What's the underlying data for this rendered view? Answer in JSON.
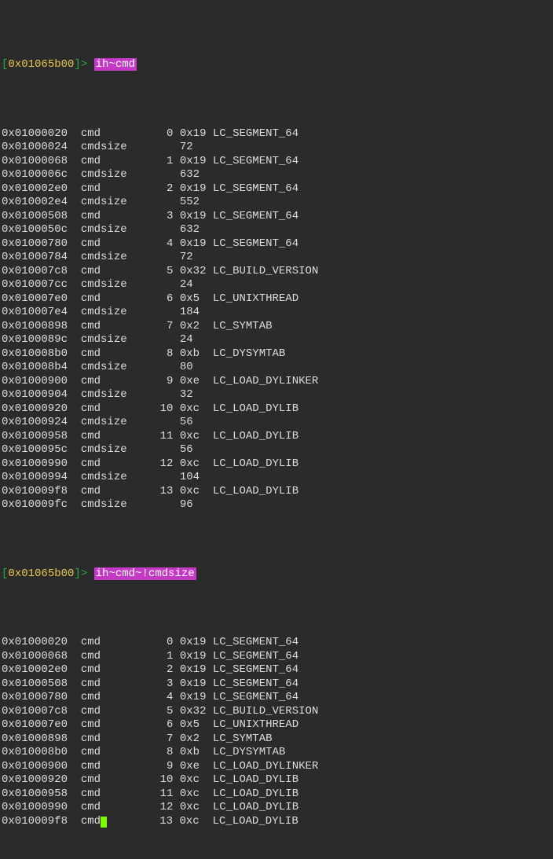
{
  "prompt1": {
    "lb": "[",
    "addr": "0x01065b00",
    "rb": "]",
    "gt": "> ",
    "command": "ih~cmd"
  },
  "block1": [
    {
      "addr": "0x01000020",
      "name": "cmd",
      "idx": "0",
      "hex": "0x19",
      "desc": "LC_SEGMENT_64"
    },
    {
      "addr": "0x01000024",
      "name": "cmdsize",
      "idx": "",
      "hex": "72",
      "desc": ""
    },
    {
      "addr": "0x01000068",
      "name": "cmd",
      "idx": "1",
      "hex": "0x19",
      "desc": "LC_SEGMENT_64"
    },
    {
      "addr": "0x0100006c",
      "name": "cmdsize",
      "idx": "",
      "hex": "632",
      "desc": ""
    },
    {
      "addr": "0x010002e0",
      "name": "cmd",
      "idx": "2",
      "hex": "0x19",
      "desc": "LC_SEGMENT_64"
    },
    {
      "addr": "0x010002e4",
      "name": "cmdsize",
      "idx": "",
      "hex": "552",
      "desc": ""
    },
    {
      "addr": "0x01000508",
      "name": "cmd",
      "idx": "3",
      "hex": "0x19",
      "desc": "LC_SEGMENT_64"
    },
    {
      "addr": "0x0100050c",
      "name": "cmdsize",
      "idx": "",
      "hex": "632",
      "desc": ""
    },
    {
      "addr": "0x01000780",
      "name": "cmd",
      "idx": "4",
      "hex": "0x19",
      "desc": "LC_SEGMENT_64"
    },
    {
      "addr": "0x01000784",
      "name": "cmdsize",
      "idx": "",
      "hex": "72",
      "desc": ""
    },
    {
      "addr": "0x010007c8",
      "name": "cmd",
      "idx": "5",
      "hex": "0x32",
      "desc": "LC_BUILD_VERSION"
    },
    {
      "addr": "0x010007cc",
      "name": "cmdsize",
      "idx": "",
      "hex": "24",
      "desc": ""
    },
    {
      "addr": "0x010007e0",
      "name": "cmd",
      "idx": "6",
      "hex": "0x5",
      "desc": "LC_UNIXTHREAD"
    },
    {
      "addr": "0x010007e4",
      "name": "cmdsize",
      "idx": "",
      "hex": "184",
      "desc": ""
    },
    {
      "addr": "0x01000898",
      "name": "cmd",
      "idx": "7",
      "hex": "0x2",
      "desc": "LC_SYMTAB"
    },
    {
      "addr": "0x0100089c",
      "name": "cmdsize",
      "idx": "",
      "hex": "24",
      "desc": ""
    },
    {
      "addr": "0x010008b0",
      "name": "cmd",
      "idx": "8",
      "hex": "0xb",
      "desc": "LC_DYSYMTAB"
    },
    {
      "addr": "0x010008b4",
      "name": "cmdsize",
      "idx": "",
      "hex": "80",
      "desc": ""
    },
    {
      "addr": "0x01000900",
      "name": "cmd",
      "idx": "9",
      "hex": "0xe",
      "desc": "LC_LOAD_DYLINKER"
    },
    {
      "addr": "0x01000904",
      "name": "cmdsize",
      "idx": "",
      "hex": "32",
      "desc": ""
    },
    {
      "addr": "0x01000920",
      "name": "cmd",
      "idx": "10",
      "hex": "0xc",
      "desc": "LC_LOAD_DYLIB"
    },
    {
      "addr": "0x01000924",
      "name": "cmdsize",
      "idx": "",
      "hex": "56",
      "desc": ""
    },
    {
      "addr": "0x01000958",
      "name": "cmd",
      "idx": "11",
      "hex": "0xc",
      "desc": "LC_LOAD_DYLIB"
    },
    {
      "addr": "0x0100095c",
      "name": "cmdsize",
      "idx": "",
      "hex": "56",
      "desc": ""
    },
    {
      "addr": "0x01000990",
      "name": "cmd",
      "idx": "12",
      "hex": "0xc",
      "desc": "LC_LOAD_DYLIB"
    },
    {
      "addr": "0x01000994",
      "name": "cmdsize",
      "idx": "",
      "hex": "104",
      "desc": ""
    },
    {
      "addr": "0x010009f8",
      "name": "cmd",
      "idx": "13",
      "hex": "0xc",
      "desc": "LC_LOAD_DYLIB"
    },
    {
      "addr": "0x010009fc",
      "name": "cmdsize",
      "idx": "",
      "hex": "96",
      "desc": ""
    }
  ],
  "prompt2": {
    "lb": "[",
    "addr": "0x01065b00",
    "rb": "]",
    "gt": "> ",
    "command": "ih~cmd~!cmdsize"
  },
  "block2": [
    {
      "addr": "0x01000020",
      "name": "cmd",
      "idx": "0",
      "hex": "0x19",
      "desc": "LC_SEGMENT_64"
    },
    {
      "addr": "0x01000068",
      "name": "cmd",
      "idx": "1",
      "hex": "0x19",
      "desc": "LC_SEGMENT_64"
    },
    {
      "addr": "0x010002e0",
      "name": "cmd",
      "idx": "2",
      "hex": "0x19",
      "desc": "LC_SEGMENT_64"
    },
    {
      "addr": "0x01000508",
      "name": "cmd",
      "idx": "3",
      "hex": "0x19",
      "desc": "LC_SEGMENT_64"
    },
    {
      "addr": "0x01000780",
      "name": "cmd",
      "idx": "4",
      "hex": "0x19",
      "desc": "LC_SEGMENT_64"
    },
    {
      "addr": "0x010007c8",
      "name": "cmd",
      "idx": "5",
      "hex": "0x32",
      "desc": "LC_BUILD_VERSION"
    },
    {
      "addr": "0x010007e0",
      "name": "cmd",
      "idx": "6",
      "hex": "0x5",
      "desc": "LC_UNIXTHREAD"
    },
    {
      "addr": "0x01000898",
      "name": "cmd",
      "idx": "7",
      "hex": "0x2",
      "desc": "LC_SYMTAB"
    },
    {
      "addr": "0x010008b0",
      "name": "cmd",
      "idx": "8",
      "hex": "0xb",
      "desc": "LC_DYSYMTAB"
    },
    {
      "addr": "0x01000900",
      "name": "cmd",
      "idx": "9",
      "hex": "0xe",
      "desc": "LC_LOAD_DYLINKER"
    },
    {
      "addr": "0x01000920",
      "name": "cmd",
      "idx": "10",
      "hex": "0xc",
      "desc": "LC_LOAD_DYLIB"
    },
    {
      "addr": "0x01000958",
      "name": "cmd",
      "idx": "11",
      "hex": "0xc",
      "desc": "LC_LOAD_DYLIB"
    },
    {
      "addr": "0x01000990",
      "name": "cmd",
      "idx": "12",
      "hex": "0xc",
      "desc": "LC_LOAD_DYLIB"
    },
    {
      "addr": "0x010009f8",
      "name": "cmd",
      "idx": "13",
      "hex": "0xc",
      "desc": "LC_LOAD_DYLIB"
    }
  ]
}
